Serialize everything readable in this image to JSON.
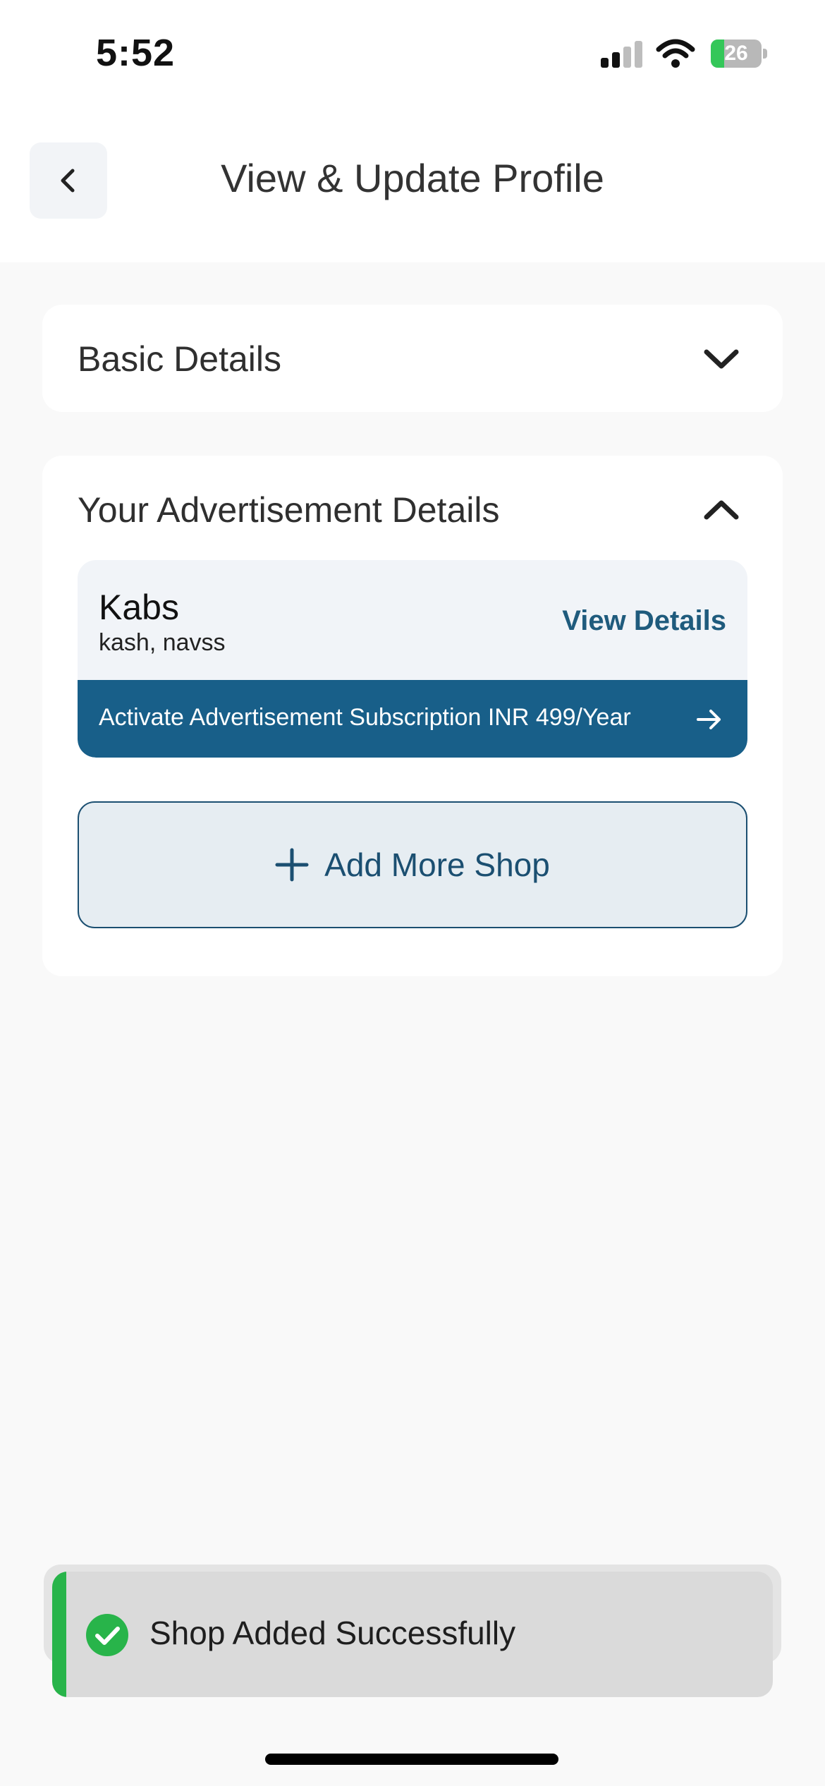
{
  "status_bar": {
    "time": "5:52",
    "battery_level": "26",
    "battery_fraction": 0.26
  },
  "header": {
    "title": "View & Update Profile"
  },
  "basic_details": {
    "title": "Basic Details",
    "expanded": false
  },
  "advertisement": {
    "title": "Your Advertisement Details",
    "expanded": true,
    "shop": {
      "name": "Kabs",
      "address": "kash, navss",
      "view_details_label": "View Details"
    },
    "activate_label": "Activate Advertisement Subscription INR 499/Year",
    "add_shop_label": "Add More Shop"
  },
  "toast": {
    "message": "Shop Added Successfully"
  },
  "colors": {
    "primary": "#185f89",
    "success": "#28b44a",
    "link": "#1f5b7d",
    "background": "#f9f9f9"
  },
  "icons": {
    "back": "chevron-left-icon",
    "collapse": "chevron-down-icon",
    "expand": "chevron-up-icon",
    "arrow": "arrow-right-icon",
    "add": "plus-icon",
    "success": "check-circle-icon"
  }
}
